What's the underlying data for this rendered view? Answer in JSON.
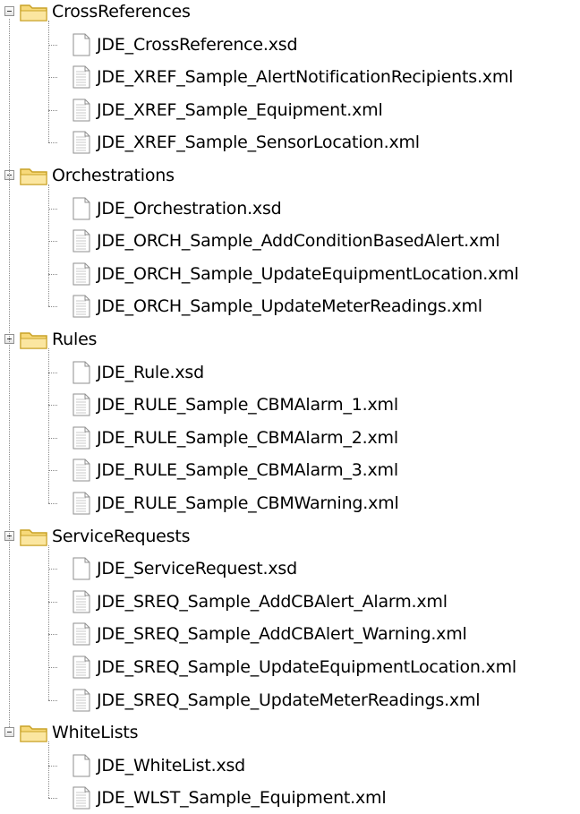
{
  "tree": [
    {
      "label": "CrossReferences",
      "expanded": true,
      "children": [
        {
          "label": "JDE_CrossReference.xsd",
          "icon": "xsd-file-icon"
        },
        {
          "label": "JDE_XREF_Sample_AlertNotificationRecipients.xml",
          "icon": "xml-file-icon"
        },
        {
          "label": "JDE_XREF_Sample_Equipment.xml",
          "icon": "xml-file-icon"
        },
        {
          "label": "JDE_XREF_Sample_SensorLocation.xml",
          "icon": "xml-file-icon"
        }
      ]
    },
    {
      "label": "Orchestrations",
      "expanded": true,
      "children": [
        {
          "label": "JDE_Orchestration.xsd",
          "icon": "xsd-file-icon"
        },
        {
          "label": "JDE_ORCH_Sample_AddConditionBasedAlert.xml",
          "icon": "xml-file-icon"
        },
        {
          "label": "JDE_ORCH_Sample_UpdateEquipmentLocation.xml",
          "icon": "xml-file-icon"
        },
        {
          "label": "JDE_ORCH_Sample_UpdateMeterReadings.xml",
          "icon": "xml-file-icon"
        }
      ]
    },
    {
      "label": "Rules",
      "expanded": true,
      "children": [
        {
          "label": "JDE_Rule.xsd",
          "icon": "xsd-file-icon"
        },
        {
          "label": "JDE_RULE_Sample_CBMAlarm_1.xml",
          "icon": "xml-file-icon"
        },
        {
          "label": "JDE_RULE_Sample_CBMAlarm_2.xml",
          "icon": "xml-file-icon"
        },
        {
          "label": "JDE_RULE_Sample_CBMAlarm_3.xml",
          "icon": "xml-file-icon"
        },
        {
          "label": "JDE_RULE_Sample_CBMWarning.xml",
          "icon": "xml-file-icon"
        }
      ]
    },
    {
      "label": "ServiceRequests",
      "expanded": true,
      "children": [
        {
          "label": "JDE_ServiceRequest.xsd",
          "icon": "xsd-file-icon"
        },
        {
          "label": "JDE_SREQ_Sample_AddCBAlert_Alarm.xml",
          "icon": "xml-file-icon"
        },
        {
          "label": "JDE_SREQ_Sample_AddCBAlert_Warning.xml",
          "icon": "xml-file-icon"
        },
        {
          "label": "JDE_SREQ_Sample_UpdateEquipmentLocation.xml",
          "icon": "xml-file-icon"
        },
        {
          "label": "JDE_SREQ_Sample_UpdateMeterReadings.xml",
          "icon": "xml-file-icon"
        }
      ]
    },
    {
      "label": "WhiteLists",
      "expanded": true,
      "children": [
        {
          "label": "JDE_WhiteList.xsd",
          "icon": "xsd-file-icon"
        },
        {
          "label": "JDE_WLST_Sample_Equipment.xml",
          "icon": "xml-file-icon"
        }
      ]
    }
  ],
  "colors": {
    "folder_fill": "#f7d97a",
    "folder_stroke": "#c9a227",
    "file_stroke": "#8f8f8f",
    "connector": "#8a8a8a"
  }
}
